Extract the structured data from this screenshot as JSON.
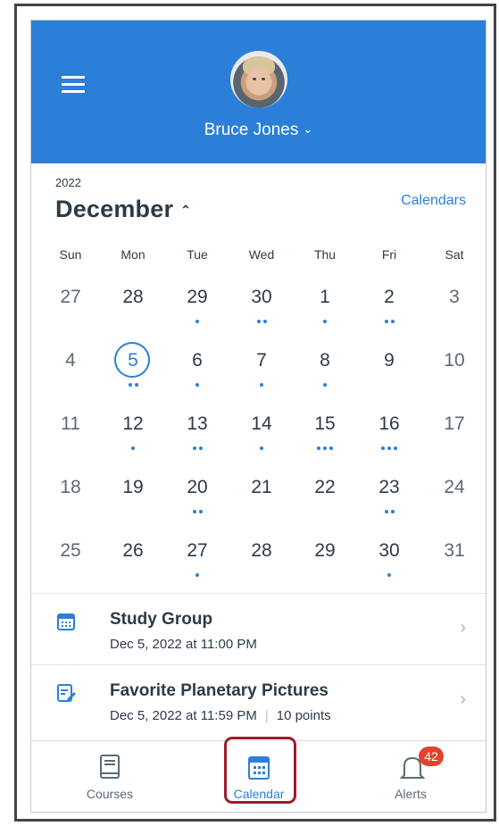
{
  "header": {
    "user_name": "Bruce Jones",
    "menu_icon": "hamburger-menu-icon",
    "dropdown_icon": "chevron-down-icon",
    "color": "#2b7fd8"
  },
  "calendar": {
    "year": "2022",
    "month": "December",
    "calendars_link": "Calendars",
    "weekdays": [
      "Sun",
      "Mon",
      "Tue",
      "Wed",
      "Thu",
      "Fri",
      "Sat"
    ],
    "weeks": [
      [
        {
          "d": "27",
          "dots": 0,
          "muted": true
        },
        {
          "d": "28",
          "dots": 0
        },
        {
          "d": "29",
          "dots": 1
        },
        {
          "d": "30",
          "dots": 2
        },
        {
          "d": "1",
          "dots": 1
        },
        {
          "d": "2",
          "dots": 2
        },
        {
          "d": "3",
          "dots": 0,
          "muted": true
        }
      ],
      [
        {
          "d": "4",
          "dots": 0,
          "muted": true
        },
        {
          "d": "5",
          "dots": 2,
          "selected": true
        },
        {
          "d": "6",
          "dots": 1
        },
        {
          "d": "7",
          "dots": 1
        },
        {
          "d": "8",
          "dots": 1
        },
        {
          "d": "9",
          "dots": 0
        },
        {
          "d": "10",
          "dots": 0,
          "muted": true
        }
      ],
      [
        {
          "d": "11",
          "dots": 0,
          "muted": true
        },
        {
          "d": "12",
          "dots": 1
        },
        {
          "d": "13",
          "dots": 2
        },
        {
          "d": "14",
          "dots": 1
        },
        {
          "d": "15",
          "dots": 3
        },
        {
          "d": "16",
          "dots": 3
        },
        {
          "d": "17",
          "dots": 0,
          "muted": true
        }
      ],
      [
        {
          "d": "18",
          "dots": 0,
          "muted": true
        },
        {
          "d": "19",
          "dots": 0
        },
        {
          "d": "20",
          "dots": 2
        },
        {
          "d": "21",
          "dots": 0
        },
        {
          "d": "22",
          "dots": 0
        },
        {
          "d": "23",
          "dots": 2
        },
        {
          "d": "24",
          "dots": 0,
          "muted": true
        }
      ],
      [
        {
          "d": "25",
          "dots": 0,
          "muted": true
        },
        {
          "d": "26",
          "dots": 0
        },
        {
          "d": "27",
          "dots": 1
        },
        {
          "d": "28",
          "dots": 0
        },
        {
          "d": "29",
          "dots": 0
        },
        {
          "d": "30",
          "dots": 1
        },
        {
          "d": "31",
          "dots": 0,
          "muted": true
        }
      ]
    ]
  },
  "events": [
    {
      "title": "Study Group",
      "date": "Dec 5, 2022 at 11:00 PM",
      "points": "",
      "icon": "calendar-event-icon"
    },
    {
      "title": "Favorite Planetary Pictures",
      "date": "Dec 5, 2022 at 11:59 PM",
      "points": "10 points",
      "icon": "assignment-icon"
    }
  ],
  "tabs": [
    {
      "label": "Courses",
      "icon": "courses-book-icon"
    },
    {
      "label": "Calendar",
      "icon": "calendar-icon",
      "active": true
    },
    {
      "label": "Alerts",
      "icon": "bell-icon",
      "badge": "42"
    }
  ]
}
